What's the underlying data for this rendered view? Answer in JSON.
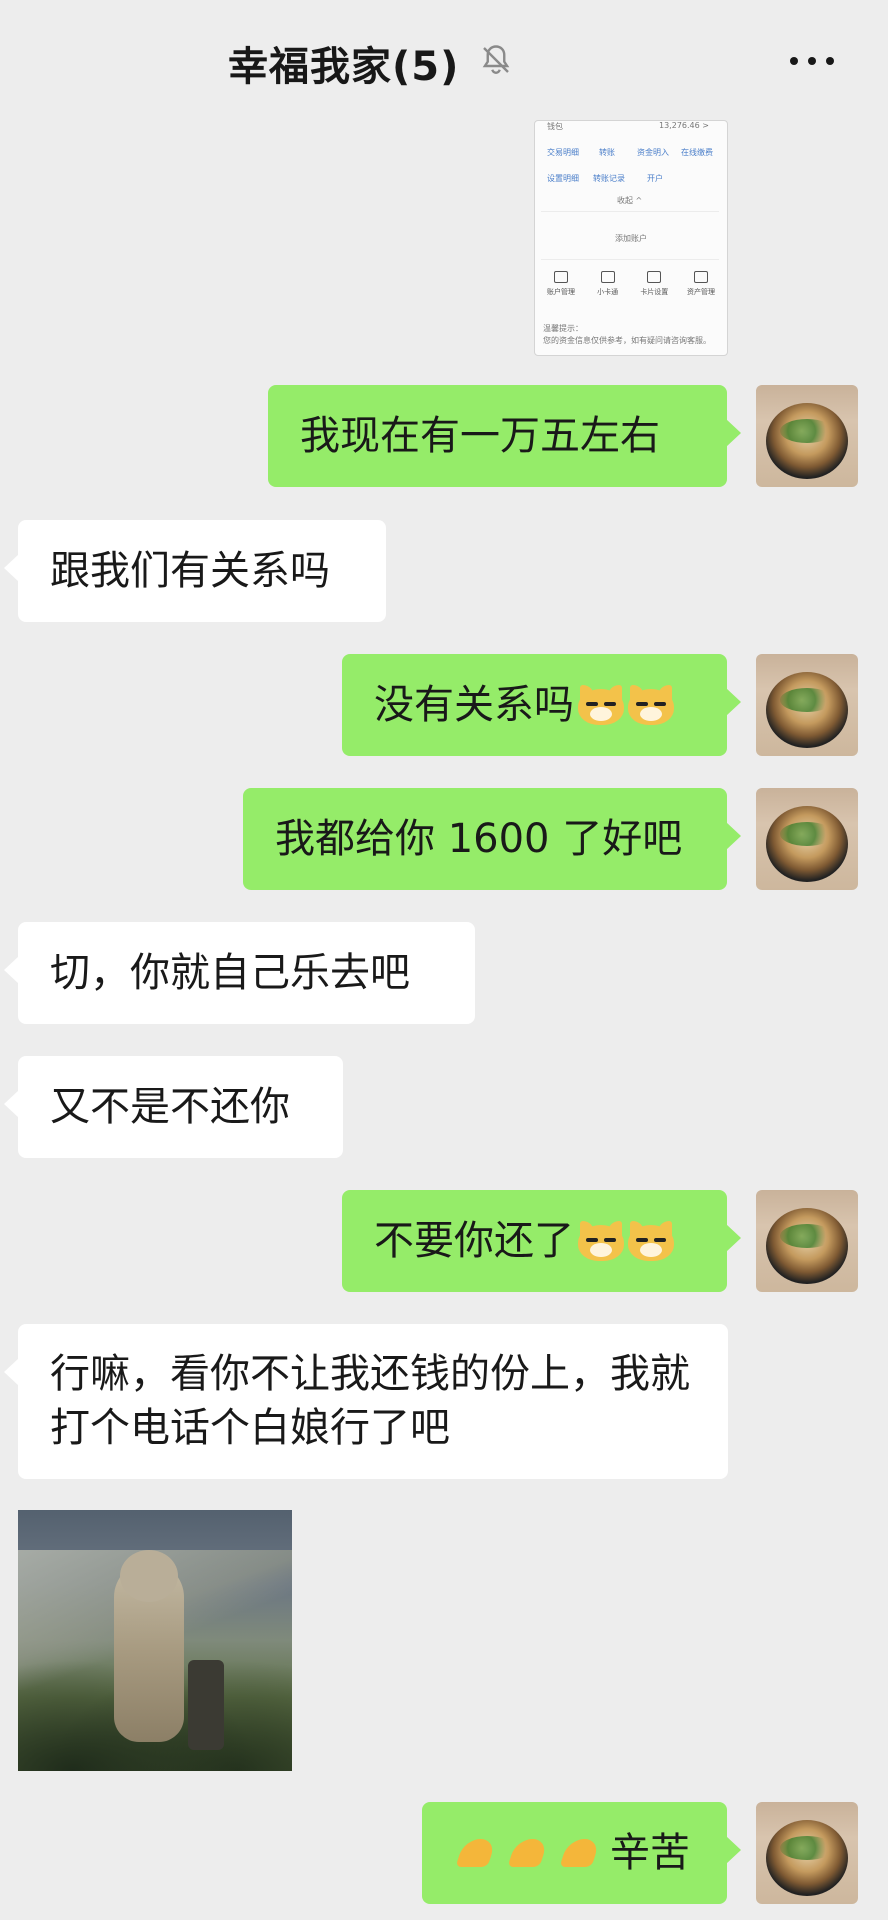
{
  "header": {
    "title": "幸福我家(5)",
    "mute_icon": "muted-bell-icon",
    "more_icon": "more-dots-icon"
  },
  "screenshot_image": {
    "row1_left": "钱包",
    "row1_right": "13,276.46 >",
    "links_row1": [
      "交易明细",
      "转账",
      "资金明入",
      "在线缴费"
    ],
    "links_row2": [
      "设置明细",
      "转账记录",
      "开户"
    ],
    "collapse": "收起 ^",
    "add_account": "添加账户",
    "icons": [
      "账户管理",
      "小卡通",
      "卡片设置",
      "资产管理"
    ],
    "footnote_title": "温馨提示：",
    "footnote_text": "您的资金信息仅供参考，如有疑问请咨询客服。"
  },
  "messages": [
    {
      "side": "right",
      "text": "我现在有一万五左右"
    },
    {
      "side": "left",
      "text": "跟我们有关系吗"
    },
    {
      "side": "right",
      "text": "没有关系吗",
      "emoji": "dog-face-emoji",
      "emoji_count": 2
    },
    {
      "side": "right",
      "text": "我都给你 1600 了好吧"
    },
    {
      "side": "left",
      "text": "切，你就自己乐去吧"
    },
    {
      "side": "left",
      "text": "又不是不还你"
    },
    {
      "side": "right",
      "text": "不要你还了",
      "emoji": "dog-face-emoji",
      "emoji_count": 2
    },
    {
      "side": "left",
      "text": "行嘛，看你不让我还钱的份上，我就打个电话个白娘行了吧"
    },
    {
      "side": "left",
      "type": "sticker",
      "sticker_name": "standing-marmot-sticker"
    },
    {
      "side": "right",
      "text": "辛苦",
      "emoji": "praying-hands-emoji",
      "emoji_count": 3
    }
  ],
  "avatars": {
    "me": "avatar-food-bowl"
  },
  "colors": {
    "background": "#ededed",
    "self_bubble": "#95ec69",
    "other_bubble": "#ffffff"
  }
}
